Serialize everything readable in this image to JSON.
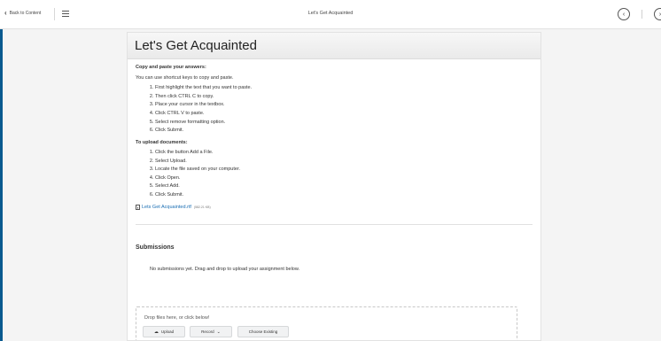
{
  "topbar": {
    "back_label": "Back to Content",
    "title": "Let's Get Acquainted",
    "prev_glyph": "‹",
    "next_glyph": "›"
  },
  "page": {
    "title": "Let's Get Acquainted"
  },
  "copy_section": {
    "heading": "Copy and paste your answers:",
    "intro": "You can use shortcut keys to copy and paste.",
    "steps": [
      "First highlight the text that you want to paste.",
      "Then click CTRL C to copy.",
      "Place your cursor in the textbox.",
      "Click CTRL V to paste.",
      "Select remove formatting option.",
      "Click Submit."
    ]
  },
  "upload_section": {
    "heading": "To upload documents:",
    "steps": [
      "Click the button Add a File.",
      "Select Upload.",
      "Locate the file saved on your computer.",
      "Click Open.",
      "Select Add.",
      "Click Submit."
    ]
  },
  "attachment": {
    "name": "Lets Get Acquainted.rtf",
    "size": "(582.21 KB)"
  },
  "submissions": {
    "heading": "Submissions",
    "empty_message": "No submissions yet. Drag and drop to upload your assignment below."
  },
  "dropzone": {
    "prompt": "Drop files here, or click below!",
    "upload_label": "Upload",
    "record_label": "Record",
    "choose_label": "Choose Existing"
  },
  "colors": {
    "accent": "#0a5a8f",
    "link": "#1a6eb3"
  }
}
